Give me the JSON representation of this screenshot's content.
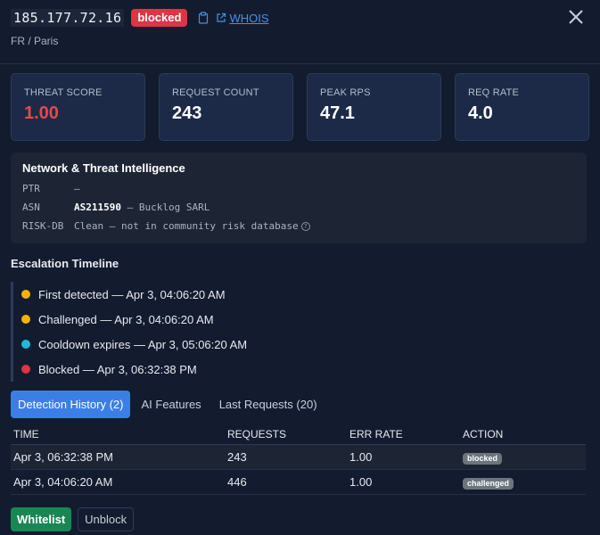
{
  "header": {
    "ip": "185.177.72.16",
    "status_badge": "blocked",
    "whois_label": "WHOIS",
    "location": "FR / Paris"
  },
  "stats": [
    {
      "label": "THREAT SCORE",
      "value": "1.00",
      "color": "#e5484d"
    },
    {
      "label": "REQUEST COUNT",
      "value": "243"
    },
    {
      "label": "PEAK RPS",
      "value": "47.1"
    },
    {
      "label": "REQ RATE",
      "value": "4.0"
    }
  ],
  "intel": {
    "title": "Network & Threat Intelligence",
    "rows": [
      {
        "key": "PTR",
        "value": "—"
      },
      {
        "key": "ASN",
        "value_bold": "AS211590",
        "value": " — Bucklog SARL"
      },
      {
        "key": "RISK-DB",
        "value": "Clean — not in community risk database"
      }
    ]
  },
  "timeline": {
    "title": "Escalation Timeline",
    "items": [
      {
        "text": "First detected — Apr 3, 04:06:20 AM",
        "color": "#f5b400"
      },
      {
        "text": "Challenged — Apr 3, 04:06:20 AM",
        "color": "#f5b400"
      },
      {
        "text": "Cooldown expires — Apr 3, 05:06:20 AM",
        "color": "#20b8d6"
      },
      {
        "text": "Blocked — Apr 3, 06:32:38 PM",
        "color": "#dc3545"
      }
    ]
  },
  "tabs": [
    {
      "label": "Detection History (2)",
      "active": true
    },
    {
      "label": "AI Features"
    },
    {
      "label": "Last Requests (20)"
    }
  ],
  "history": {
    "headers": [
      "TIME",
      "REQUESTS",
      "ERR RATE",
      "ACTION"
    ],
    "rows": [
      {
        "time": "Apr 3, 06:32:38 PM",
        "requests": "243",
        "err_rate": "1.00",
        "action": "blocked"
      },
      {
        "time": "Apr 3, 04:06:20 AM",
        "requests": "446",
        "err_rate": "1.00",
        "action": "challenged"
      }
    ]
  },
  "actions": {
    "whitelist": "Whitelist",
    "unblock": "Unblock"
  }
}
